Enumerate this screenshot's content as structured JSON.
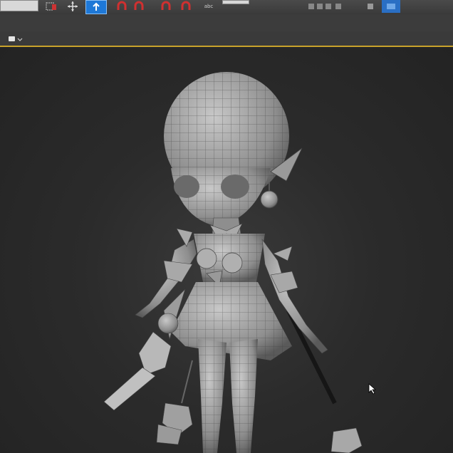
{
  "toolbar": {
    "tools": [
      {
        "name": "selection-field",
        "icon": "field"
      },
      {
        "name": "select-region",
        "icon": "select-region-icon"
      },
      {
        "name": "move",
        "icon": "move-icon"
      },
      {
        "name": "rotate-active",
        "icon": "rotate-icon"
      },
      {
        "name": "snap-toggle",
        "icon": "magnet-icon"
      },
      {
        "name": "angle-snap",
        "icon": "magnet-icon"
      },
      {
        "name": "percent-snap",
        "icon": "magnet-icon"
      },
      {
        "name": "spinner-snap",
        "icon": "magnet-icon"
      },
      {
        "name": "edit-named-selection",
        "icon": "abc-icon"
      }
    ],
    "abc_label": "abc"
  },
  "viewport": {
    "menu_icon": "viewport-menu-icon",
    "highlight_color": "#c8a22b"
  },
  "model": {
    "description_icon": "character-mesh-icon",
    "shading": "wireframe-on-shaded"
  },
  "colors": {
    "toolbar_bg": "#3a3a3a",
    "viewport_bg": "#2b2b2b",
    "active_tool": "#1e78d7",
    "magnet_red": "#d03030",
    "mesh_gray": "#9a9a9a"
  }
}
